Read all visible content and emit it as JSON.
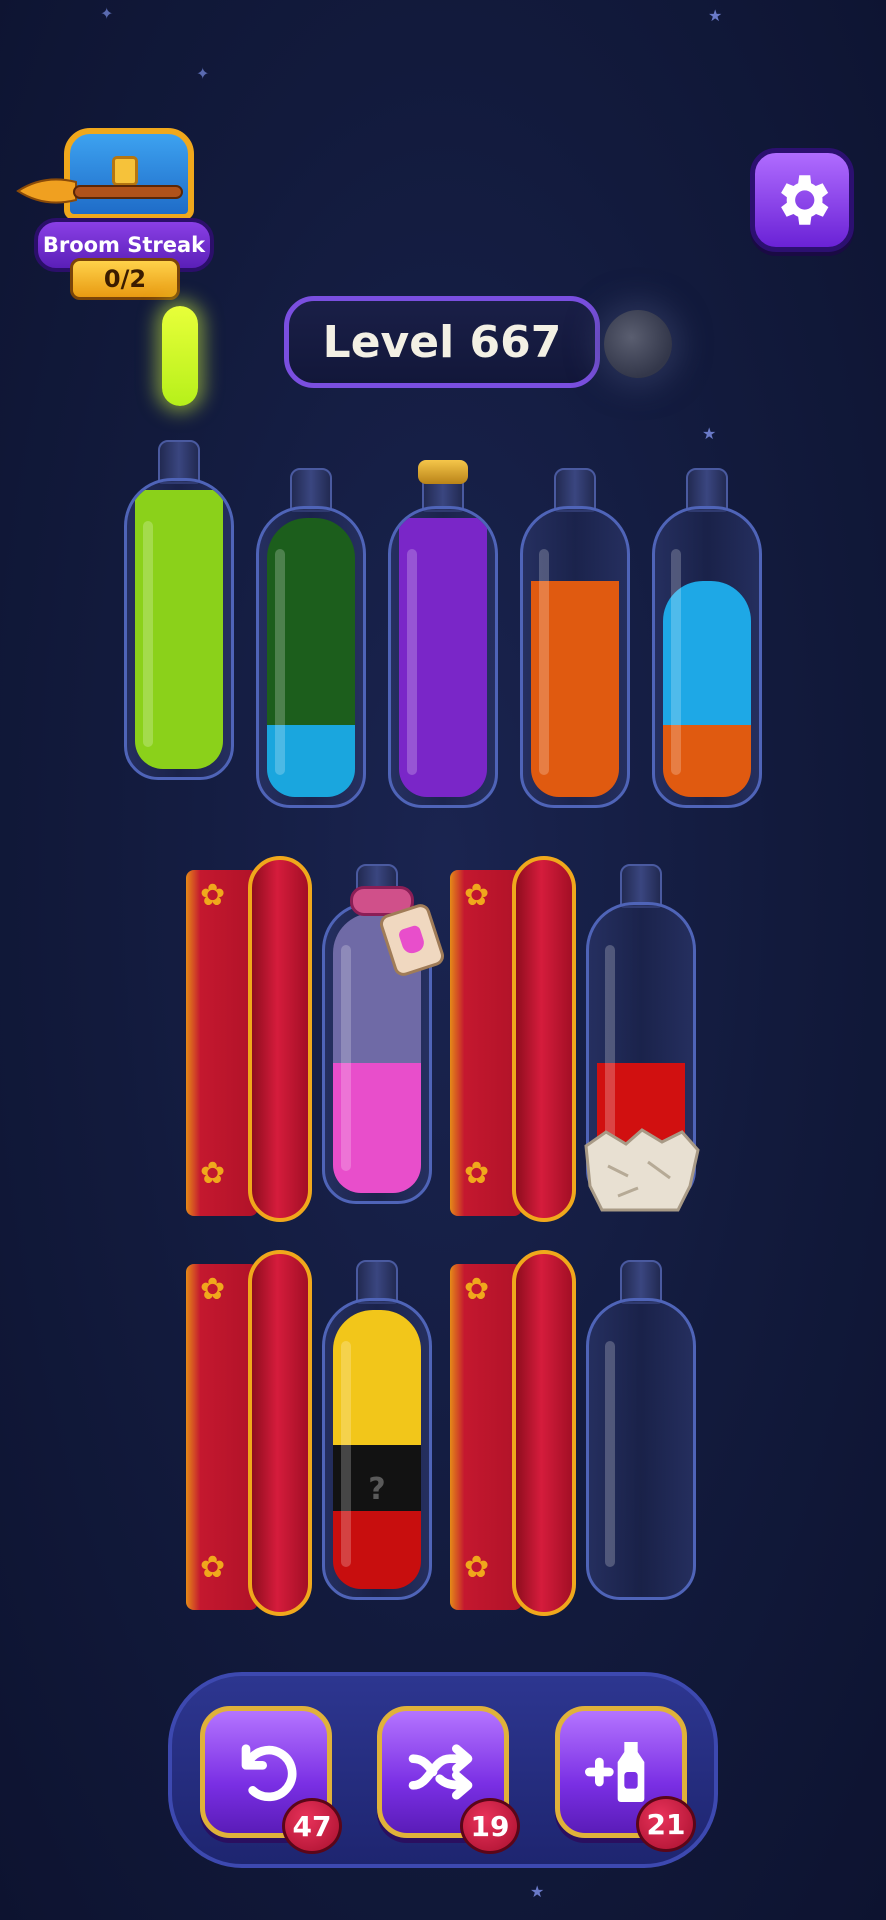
{
  "streak": {
    "title": "Broom Streak",
    "count": "0/2"
  },
  "level": {
    "label": "Level 667"
  },
  "bottles": [
    {
      "name": "bottle-1",
      "layers": [
        {
          "color": "#8bd11a",
          "fraction": 0.97
        }
      ]
    },
    {
      "name": "bottle-2",
      "layers": [
        {
          "color": "#1c5e1c",
          "fraction": 0.72
        },
        {
          "color": "#1aa6de",
          "fraction": 0.25
        }
      ]
    },
    {
      "name": "bottle-3",
      "cork": true,
      "layers": [
        {
          "color": "#7a26c8",
          "fraction": 0.97
        }
      ]
    },
    {
      "name": "bottle-4",
      "layers": [
        {
          "color": "#e05a10",
          "fraction": 0.75
        }
      ]
    },
    {
      "name": "bottle-5",
      "layers": [
        {
          "color": "#1ea8e6",
          "fraction": 0.5
        },
        {
          "color": "#e05a10",
          "fraction": 0.25
        }
      ]
    },
    {
      "name": "bottle-6-tied",
      "layers": [
        {
          "color": "#6f6aa6",
          "fraction": 0.52
        },
        {
          "color": "#e84ecb",
          "fraction": 0.45
        }
      ]
    },
    {
      "name": "bottle-7-rock",
      "layers": [
        {
          "color": "#d11010",
          "fraction": 0.45
        }
      ]
    },
    {
      "name": "bottle-8-mystery",
      "layers": [
        {
          "color": "#f2c61a",
          "fraction": 0.47
        },
        {
          "color": "#121212",
          "fraction": 0.23
        },
        {
          "color": "#c80e0e",
          "fraction": 0.27
        }
      ]
    },
    {
      "name": "bottle-9-empty",
      "layers": []
    }
  ],
  "mystery_mark": "?",
  "boosters": {
    "undo": {
      "count": "47"
    },
    "shuffle": {
      "count": "19"
    },
    "add_bottle": {
      "count": "21"
    }
  },
  "icons": {
    "settings": "gear-icon",
    "undo": "undo-arrow-icon",
    "shuffle": "shuffle-arrows-icon",
    "add_bottle": "plus-bottle-icon",
    "streak": "treasure-chest-icon"
  },
  "colors": {
    "accent": "#7a2fe4",
    "badge": "#c8183e",
    "gold": "#f0a81c"
  }
}
